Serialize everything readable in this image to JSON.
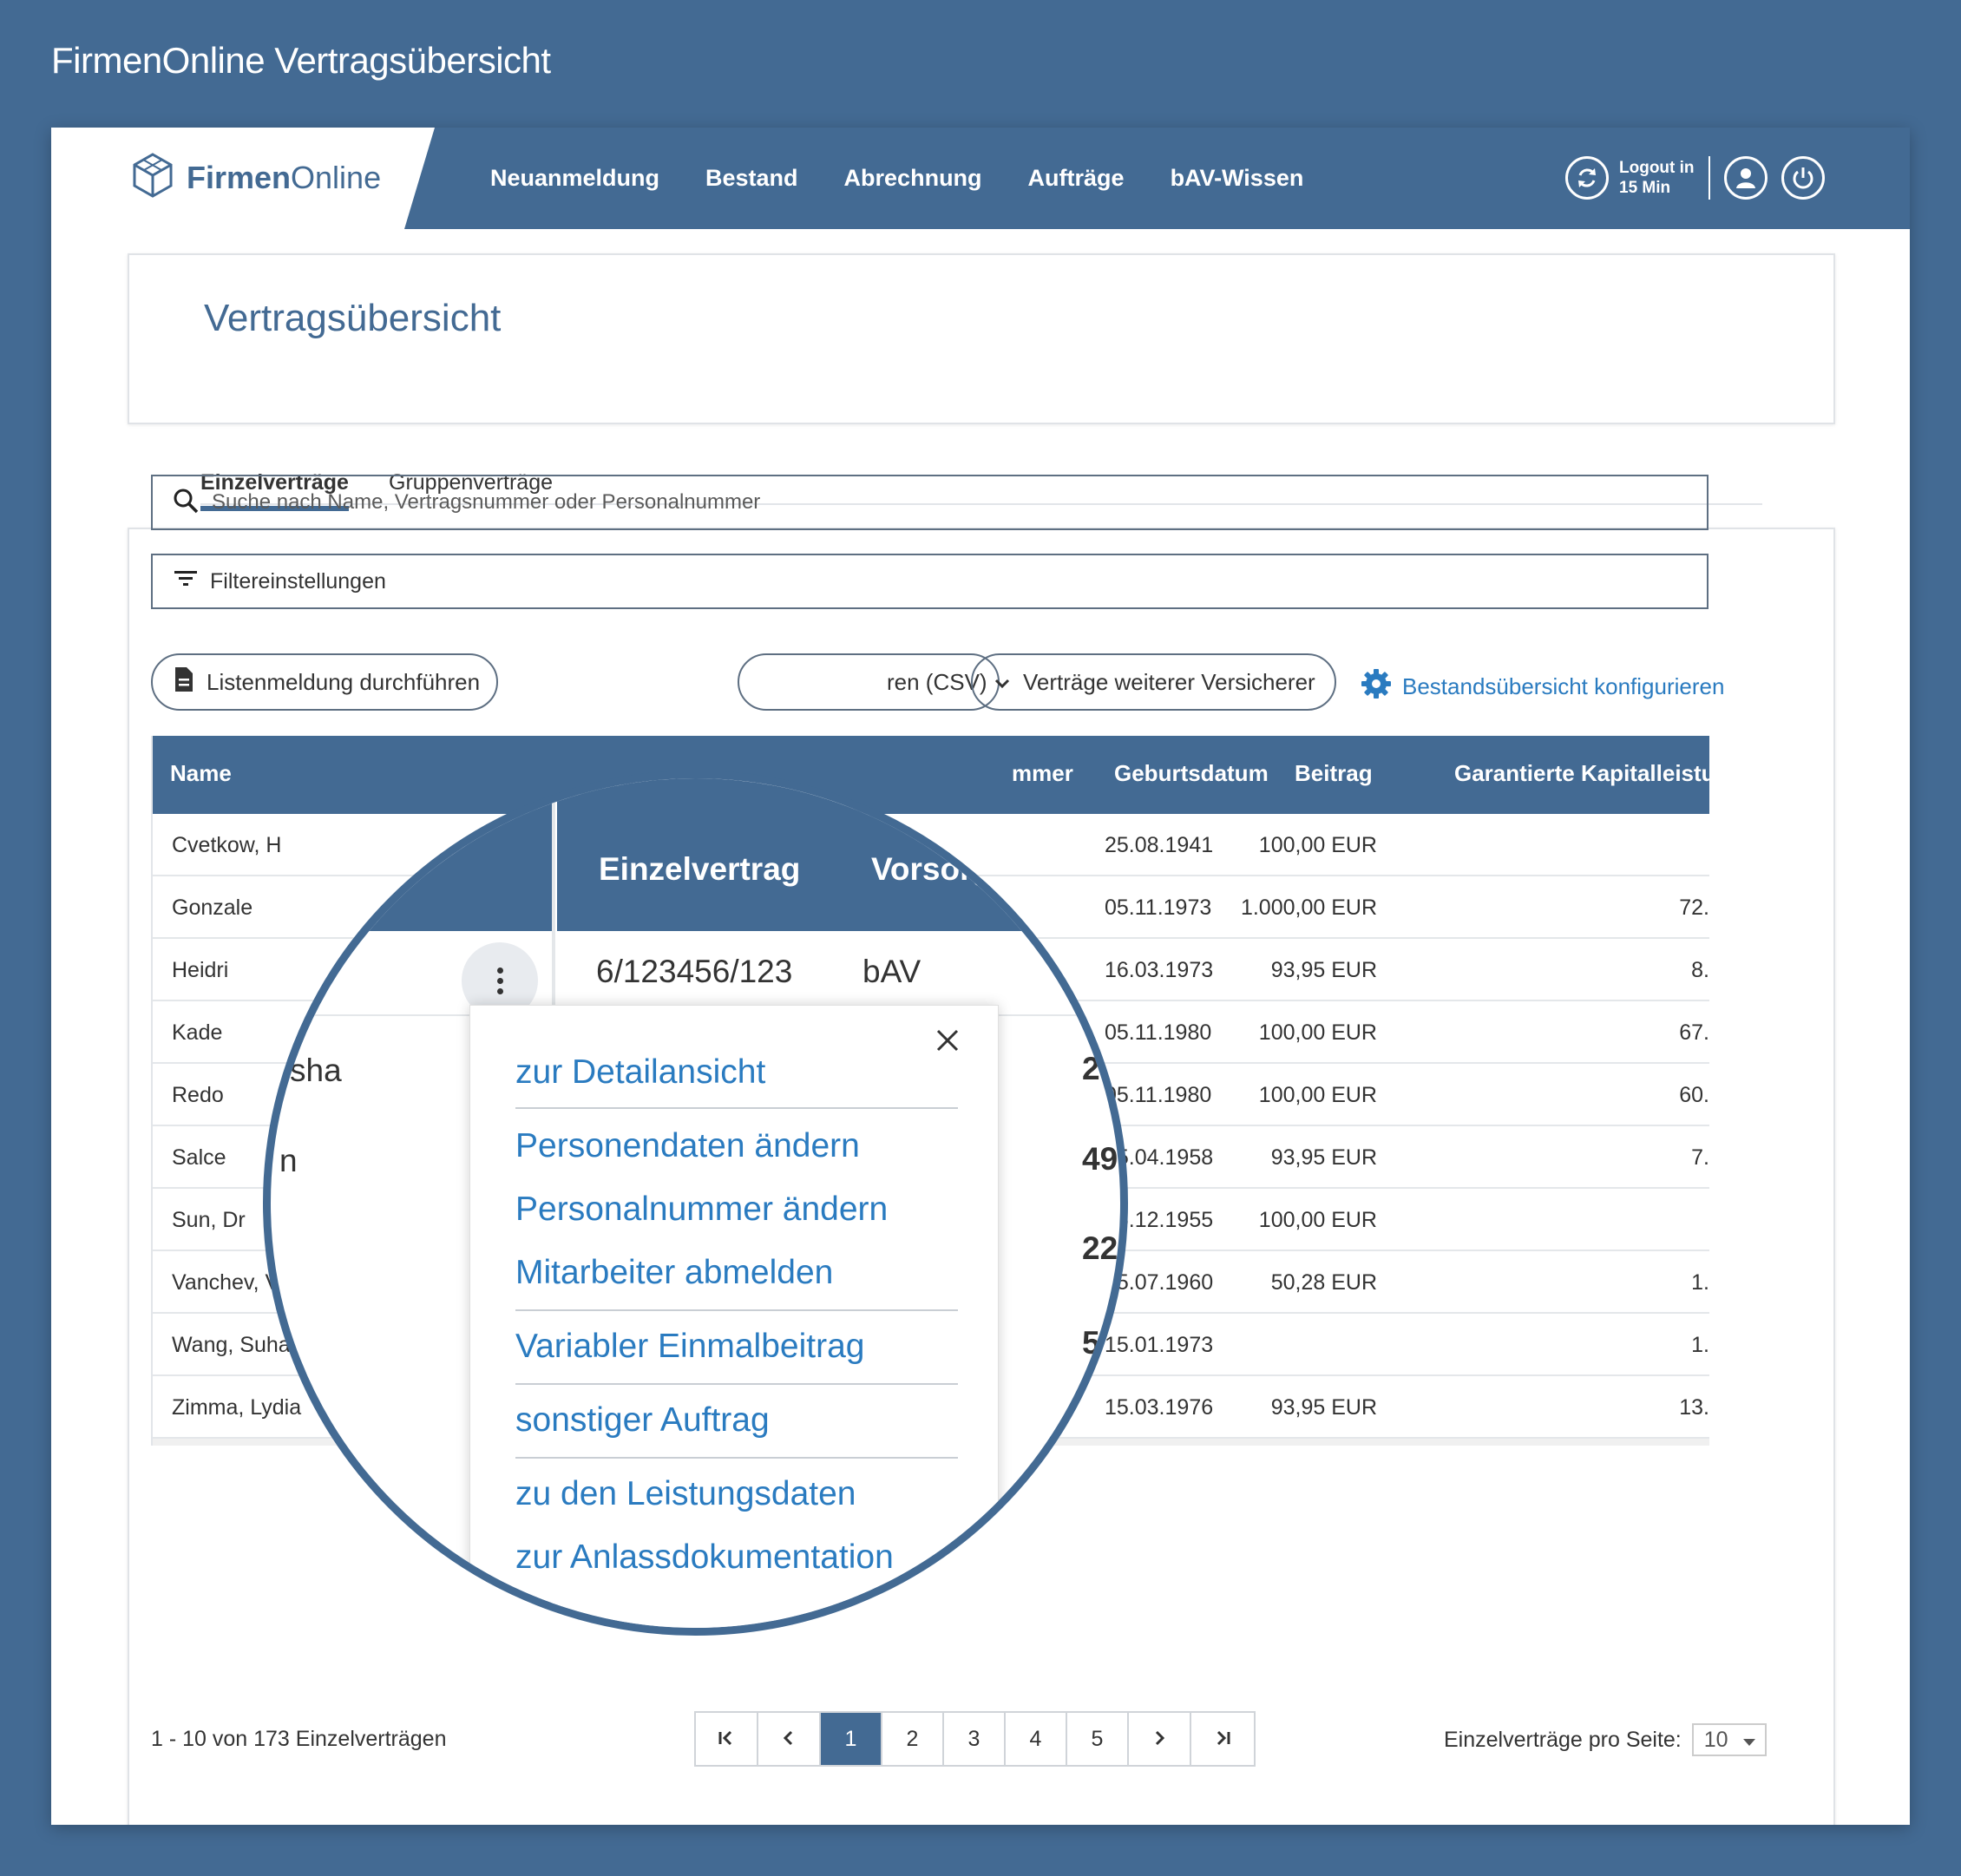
{
  "outer_title": "FirmenOnline Vertragsübersicht",
  "brand": {
    "bold": "Firmen",
    "light": "Online"
  },
  "nav": [
    "Neuanmeldung",
    "Bestand",
    "Abrechnung",
    "Aufträge",
    "bAV-Wissen"
  ],
  "header": {
    "logout_line1": "Logout in",
    "logout_line2": "15 Min"
  },
  "page_title": "Vertragsübersicht",
  "tabs": [
    "Einzelverträge",
    "Gruppenverträge"
  ],
  "search": {
    "placeholder": "Suche nach Name, Vertragsnummer oder Personalnummer"
  },
  "filter_label": "Filtereinstellungen",
  "actions": {
    "listenmeldung": "Listenmeldung durchführen",
    "csv": "ren (CSV)",
    "weitere": "Verträge weiterer Versicherer",
    "konfigurieren": "Bestandsübersicht konfigurieren"
  },
  "table": {
    "headers": {
      "name": "Name",
      "nummer": "mmer",
      "geburtsdatum": "Geburtsdatum",
      "beitrag": "Beitrag",
      "kapital": "Garantierte Kapitalleistung bei"
    },
    "rows": [
      {
        "name": "Cvetkow, H",
        "dob": "25.08.1941",
        "beitrag": "100,00 EUR",
        "kap": ""
      },
      {
        "name": "Gonzale",
        "dob": "05.11.1973",
        "beitrag": "1.000,00 EUR",
        "kap": "72."
      },
      {
        "name": "Heidri",
        "dob": "16.03.1973",
        "beitrag": "93,95 EUR",
        "kap": "8."
      },
      {
        "name": "Kade",
        "dob": "05.11.1980",
        "beitrag": "100,00 EUR",
        "kap": "67."
      },
      {
        "name": "Redo",
        "dob": "05.11.1980",
        "beitrag": "100,00 EUR",
        "kap": "60."
      },
      {
        "name": "Salce",
        "dob": "25.04.1958",
        "beitrag": "93,95 EUR",
        "kap": "7."
      },
      {
        "name": "Sun, Dr",
        "dob": "26.12.1955",
        "beitrag": "100,00 EUR",
        "kap": ""
      },
      {
        "name": "Vanchev, Vi",
        "dob": "15.07.1960",
        "beitrag": "50,28 EUR",
        "kap": "1."
      },
      {
        "name": "Wang, Suha",
        "dob": "15.01.1973",
        "beitrag": "",
        "kap": "1."
      },
      {
        "name": "Zimma, Lydia",
        "dob": "15.03.1976",
        "beitrag": "93,95 EUR",
        "kap": "13."
      }
    ]
  },
  "magnifier": {
    "header_einzelvertrag": "Einzelvertrag",
    "header_vorsorg": "Vorsorg",
    "row1_vertrag": "6/123456/123",
    "row1_typ": "bAV",
    "frag_sha": "sha",
    "frag_n": "n",
    "frag_2": "2",
    "frag_49": "49",
    "frag_22": "22",
    "frag_5": "5",
    "menu": [
      "zur Detailansicht",
      "Personendaten ändern",
      "Personalnummer ändern",
      "Mitarbeiter abmelden",
      "Variabler Einmalbeitrag",
      "sonstiger Auftrag",
      "zu den Leistungsdaten",
      "zur Anlassdokumentation"
    ]
  },
  "pagination": {
    "summary": "1 - 10 von 173 Einzelverträgen",
    "pages": [
      "1",
      "2",
      "3",
      "4",
      "5"
    ],
    "per_page_label": "Einzelverträge pro Seite:",
    "per_page_value": "10"
  },
  "colors": {
    "primary": "#436a93",
    "link": "#2a7bc0",
    "background": "#436a93"
  }
}
